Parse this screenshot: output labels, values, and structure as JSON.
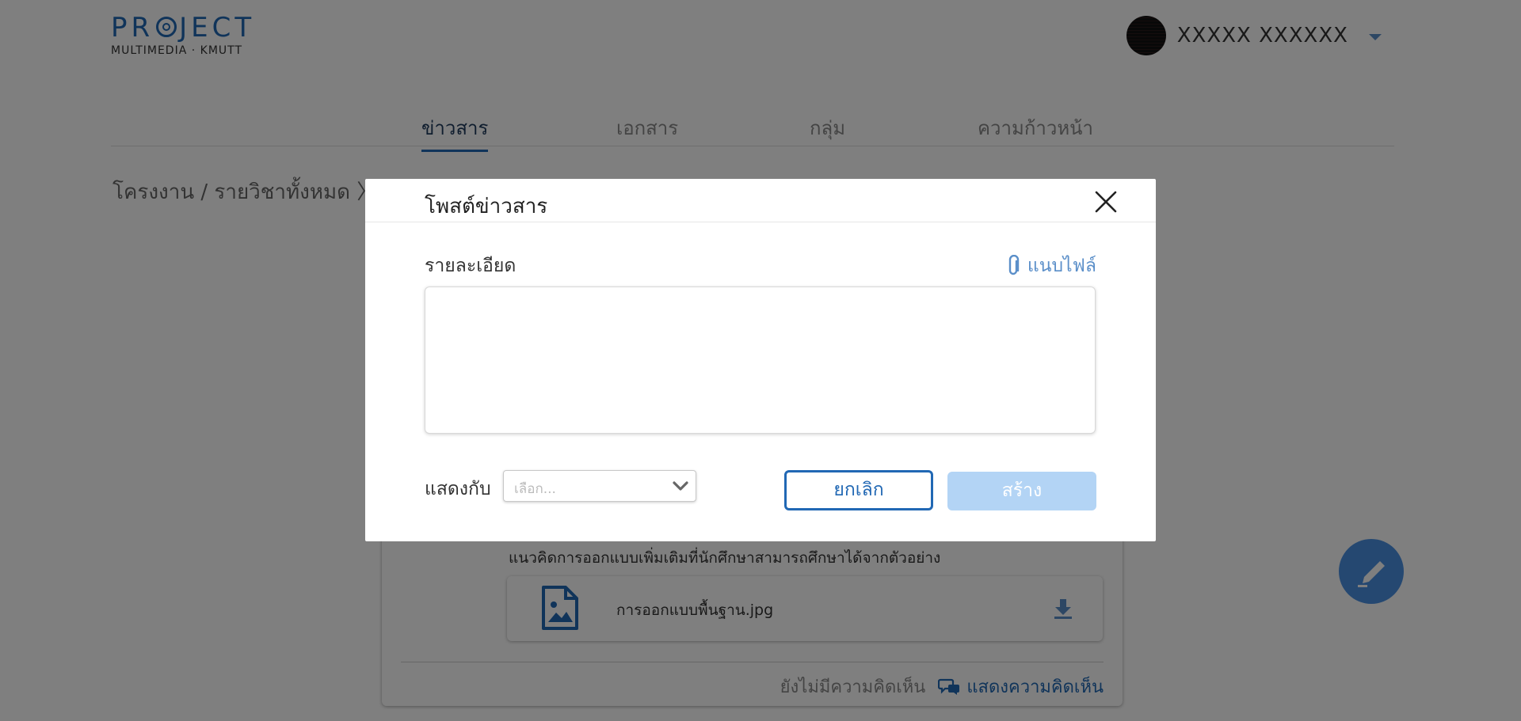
{
  "header": {
    "logo_main": "PROJECT",
    "logo_sub": "MULTIMEDIA · KMUTT",
    "user_name": "XXXXX XXXXXX"
  },
  "tabs": [
    {
      "label": "ข่าวสาร",
      "active": true
    },
    {
      "label": "เอกสาร",
      "active": false
    },
    {
      "label": "กลุ่ม",
      "active": false
    },
    {
      "label": "ความก้าวหน้า",
      "active": false
    }
  ],
  "breadcrumb": "โครงงาน / รายวิชาทั้งหมด 〉",
  "post": {
    "description": "แนวคิดการออกแบบเพิ่มเติมที่นักศึกษาสามารถศึกษาได้จากตัวอย่าง",
    "file_name": "การออกแบบพื้นฐาน.jpg",
    "no_comment": "ยังไม่มีความคิดเห็น",
    "show_comment": "แสดงความคิดเห็น"
  },
  "modal": {
    "title": "โพสต์ข่าวสาร",
    "detail_label": "รายละเอียด",
    "attach_label": "แนบไฟล์",
    "detail_value": "",
    "show_with_label": "แสดงกับ",
    "select_placeholder": "เลือก...",
    "cancel_label": "ยกเลิก",
    "create_label": "สร้าง"
  },
  "colors": {
    "accent": "#2168b4",
    "create_disabled": "#b3d4f5",
    "fab": "#4a90e2",
    "overlay": "rgba(0,0,0,0.5)"
  },
  "icons": [
    "chevron-down-icon",
    "close-icon",
    "paperclip-icon",
    "image-file-icon",
    "download-icon",
    "comment-icon",
    "pencil-icon"
  ]
}
